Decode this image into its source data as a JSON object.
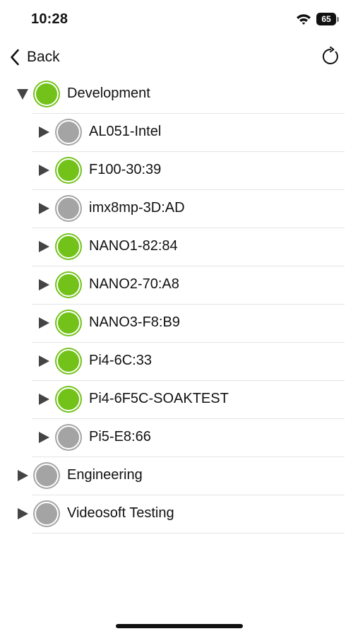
{
  "status": {
    "time": "10:28",
    "battery": "65"
  },
  "nav": {
    "back_label": "Back"
  },
  "colors": {
    "online": "#72c21a",
    "offline": "#a4a4a4"
  },
  "tree": [
    {
      "label": "Development",
      "expanded": true,
      "status": "online",
      "children": [
        {
          "label": "AL051-Intel",
          "status": "offline"
        },
        {
          "label": "F100-30:39",
          "status": "online"
        },
        {
          "label": "imx8mp-3D:AD",
          "status": "offline"
        },
        {
          "label": "NANO1-82:84",
          "status": "online"
        },
        {
          "label": "NANO2-70:A8",
          "status": "online"
        },
        {
          "label": "NANO3-F8:B9",
          "status": "online"
        },
        {
          "label": "Pi4-6C:33",
          "status": "online"
        },
        {
          "label": "Pi4-6F5C-SOAKTEST",
          "status": "online"
        },
        {
          "label": "Pi5-E8:66",
          "status": "offline"
        }
      ]
    },
    {
      "label": "Engineering",
      "expanded": false,
      "status": "offline",
      "children": []
    },
    {
      "label": "Videosoft Testing",
      "expanded": false,
      "status": "offline",
      "children": []
    }
  ]
}
